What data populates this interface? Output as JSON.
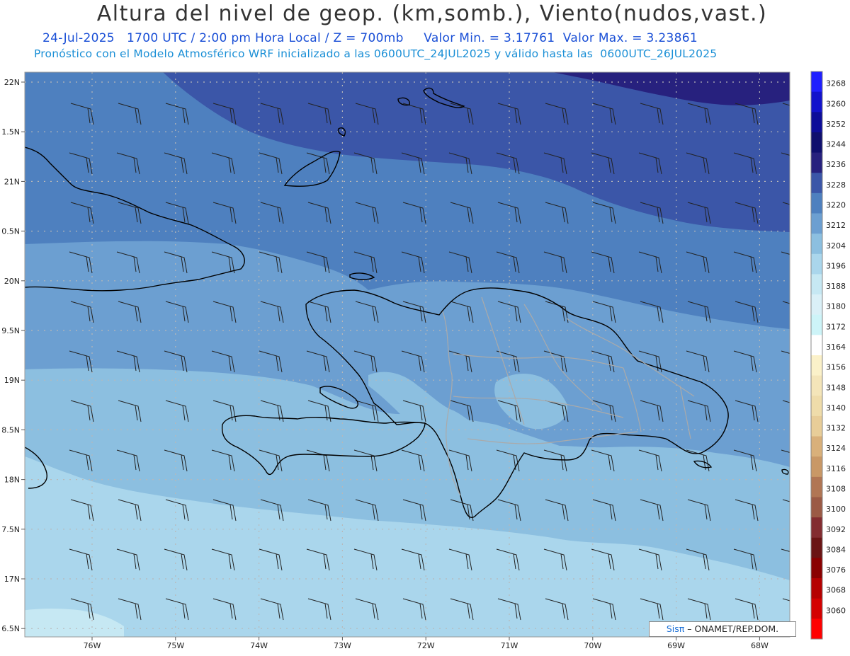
{
  "header": {
    "title": "Altura del nivel de geop. (km,somb.), Viento(nudos,vast.)",
    "date": "24-Jul-2025",
    "time": "1700 UTC / 2:00 pm Hora Local / Z = 700mb",
    "min_label": "Valor Min. = 3.17761",
    "max_label": "Valor Max. = 3.23861",
    "model_line": "Pronóstico con el Modelo Atmosférico WRF inicializado a las 0600UTC_24JUL2025 y válido hasta las  0600UTC_26JUL2025"
  },
  "axes": {
    "lat_labels": [
      "22N",
      "1.5N",
      "21N",
      "0.5N",
      "20N",
      "9.5N",
      "19N",
      "8.5N",
      "18N",
      "7.5N",
      "17N",
      "6.5N"
    ],
    "lon_labels": [
      "76W",
      "75W",
      "74W",
      "73W",
      "72W",
      "71W",
      "70W",
      "69W",
      "68W"
    ]
  },
  "colorbar": {
    "labels": [
      "3268",
      "3260",
      "3252",
      "3244",
      "3236",
      "3228",
      "3220",
      "3212",
      "3204",
      "3196",
      "3188",
      "3180",
      "3172",
      "3164",
      "3156",
      "3148",
      "3140",
      "3132",
      "3124",
      "3116",
      "3108",
      "3100",
      "3092",
      "3084",
      "3076",
      "3068",
      "3060"
    ],
    "colors": [
      "#1f1fff",
      "#1212cc",
      "#0d0d99",
      "#0f0f6e",
      "#27217e",
      "#3b56a8",
      "#4e80bf",
      "#6c9fd1",
      "#8cbfe0",
      "#aad6ec",
      "#c6e8f3",
      "#daf0f7",
      "#cdf4f8",
      "#ffffff",
      "#fbf1c9",
      "#f4e5b9",
      "#efdcaa",
      "#e8cd98",
      "#d9b07a",
      "#c99866",
      "#b17654",
      "#9b5a45",
      "#832c30",
      "#6a1414",
      "#8a0000",
      "#b50000",
      "#d40000",
      "#ff0000"
    ]
  },
  "fill_colors": {
    "band_3236": "#27217e",
    "band_3228": "#3b56a8",
    "band_3220": "#4e80bf",
    "band_3212": "#6c9fd1",
    "band_3204": "#8cbfe0",
    "band_3196": "#aad6ec"
  },
  "credit": {
    "logo": "Sis",
    "pi": "π",
    "text": " – ONAMET/REP.DOM."
  }
}
